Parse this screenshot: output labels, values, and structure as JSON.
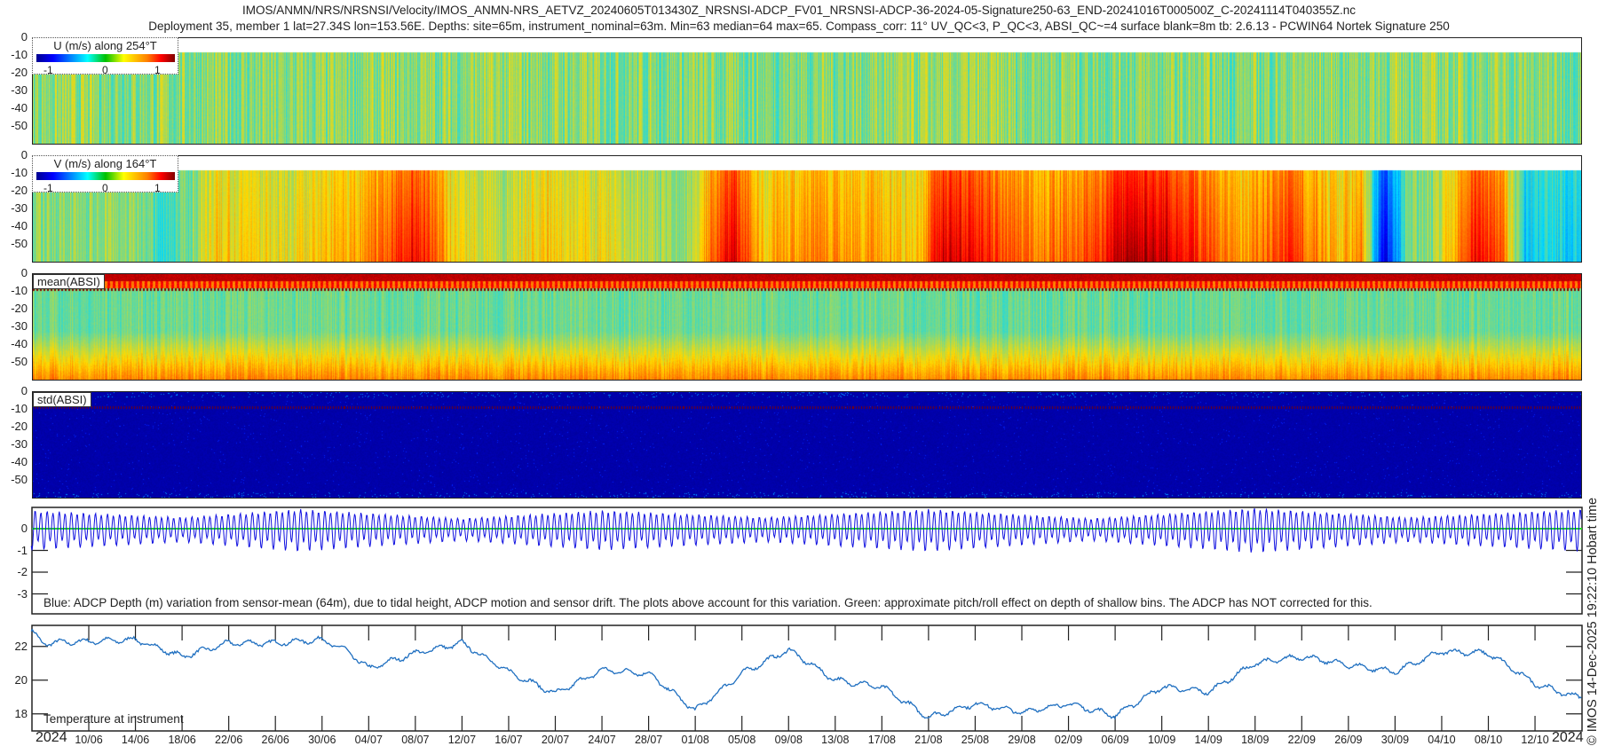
{
  "header": {
    "title_line1": "IMOS/ANMN/NRS/NRSNSI/Velocity/IMOS_ANMN-NRS_AETVZ_20240605T013430Z_NRSNSI-ADCP_FV01_NRSNSI-ADCP-36-2024-05-Signature250-63_END-20241016T000500Z_C-20241114T040355Z.nc",
    "title_line2": "Deployment 35, member 1 lat=27.34S lon=153.56E. Depths: site=65m, instrument_nominal=63m. Min=63 median=64 max=65. Compass_corr: 11° UV_QC<3, P_QC<3, ABSI_QC~=4 surface blank=8m tb: 2.6.13 - PCWIN64 Nortek Signature 250"
  },
  "credit": "© IMOS 14-Dec-2025 19:22:10 Hobart time",
  "panels": {
    "u": {
      "legend_title": "U (m/s) along 254°T",
      "cb_ticks": [
        "-1",
        "0",
        "1"
      ]
    },
    "v": {
      "legend_title": "V (m/s) along 164°T",
      "cb_ticks": [
        "-1",
        "0",
        "1"
      ]
    },
    "mean": {
      "label": "mean(ABSI)"
    },
    "std": {
      "label": "std(ABSI)"
    },
    "depth": {
      "note": "Blue: ADCP Depth (m) variation from sensor-mean (64m), due to tidal height, ADCP motion and sensor drift. The plots above account for this variation. Green: approximate pitch/roll effect on depth of shallow bins. The ADCP has NOT corrected for this."
    },
    "temp": {
      "note": "Temperature at instrument"
    }
  },
  "colors": {
    "depth_line": "#1010e0",
    "pitch_line": "#22dd22",
    "temp_line": "#1f6fc0",
    "frame": "#222222"
  },
  "chart_data": {
    "type": "line",
    "x_axis": {
      "year_left": "2024",
      "year_right": "2024",
      "tick_labels": [
        "10/06",
        "14/06",
        "18/06",
        "22/06",
        "26/06",
        "30/06",
        "04/07",
        "08/07",
        "12/07",
        "16/07",
        "20/07",
        "24/07",
        "28/07",
        "01/08",
        "05/08",
        "09/08",
        "13/08",
        "17/08",
        "21/08",
        "25/08",
        "29/08",
        "02/09",
        "06/09",
        "10/09",
        "14/09",
        "18/09",
        "22/09",
        "26/09",
        "30/09",
        "04/10",
        "08/10",
        "12/10"
      ],
      "range_days_since_0506": [
        0.07,
        133
      ]
    },
    "heatmap_depth_ticks": [
      "0",
      "-10",
      "-20",
      "-30",
      "-40",
      "-50"
    ],
    "heatmap_depth_range_m": [
      0,
      60
    ],
    "u_velocity": {
      "clim": [
        -1.2,
        1.2
      ],
      "days": [
        0,
        20,
        40,
        60,
        80,
        100,
        120,
        133
      ],
      "mean_ms": [
        0.05,
        0.0,
        0.05,
        0.0,
        0.05,
        0.0,
        0.05,
        0.0
      ]
    },
    "v_velocity": {
      "clim": [
        -1.2,
        1.2
      ],
      "days": [
        0,
        8,
        12,
        16,
        22,
        28,
        33,
        36,
        40,
        44,
        50,
        56,
        60,
        63,
        66,
        72,
        76,
        78,
        80,
        86,
        90,
        94,
        96,
        98,
        100,
        104,
        108,
        112,
        114,
        116,
        118,
        120,
        124,
        126,
        128,
        130,
        133
      ],
      "mean_ms": [
        0.0,
        0.05,
        -0.2,
        0.3,
        0.2,
        0.4,
        0.85,
        0.3,
        0.1,
        0.3,
        0.2,
        0.0,
        0.9,
        0.3,
        0.5,
        0.4,
        0.3,
        0.9,
        0.85,
        0.5,
        0.6,
        0.95,
        1.0,
        0.9,
        0.7,
        0.4,
        0.7,
        0.3,
        0.5,
        -0.9,
        0.0,
        0.0,
        0.8,
        0.6,
        -0.3,
        -0.2,
        -0.3
      ]
    },
    "depth_variation": {
      "ylim": [
        -1,
        3.9
      ],
      "tick_labels": [
        "0",
        "-1",
        "-2",
        "-3"
      ],
      "tidal_period_hours": 12.42,
      "amplitude_m": [
        0.8,
        0.5,
        0.85,
        0.45,
        0.8,
        0.5,
        0.85,
        0.45,
        0.9,
        0.5,
        0.85
      ],
      "amplitude_days": [
        0,
        13,
        23,
        37,
        49,
        63,
        77,
        91,
        105,
        118,
        133
      ]
    },
    "temperature": {
      "ylim": [
        17,
        23.25
      ],
      "tick_labels": [
        "22",
        "20",
        "18"
      ],
      "tick_values": [
        22,
        20,
        18
      ],
      "days": [
        0,
        1,
        5,
        9,
        13,
        17,
        21,
        25,
        27,
        29,
        33,
        37,
        41,
        45,
        49,
        53,
        57,
        61,
        65,
        69,
        73,
        77,
        81,
        85,
        89,
        93,
        97,
        101,
        105,
        109,
        113,
        117,
        121,
        125,
        129,
        132,
        133
      ],
      "values_c": [
        23.0,
        22.2,
        22.3,
        22.4,
        21.4,
        22.2,
        22.2,
        22.4,
        21.8,
        20.7,
        21.6,
        22.2,
        20.5,
        19.2,
        20.6,
        20.4,
        18.2,
        20.4,
        21.8,
        20.0,
        19.6,
        17.8,
        18.6,
        18.1,
        18.6,
        17.9,
        19.6,
        19.3,
        21.0,
        21.4,
        20.9,
        20.5,
        21.7,
        21.6,
        19.8,
        19.1,
        19.0
      ]
    }
  }
}
